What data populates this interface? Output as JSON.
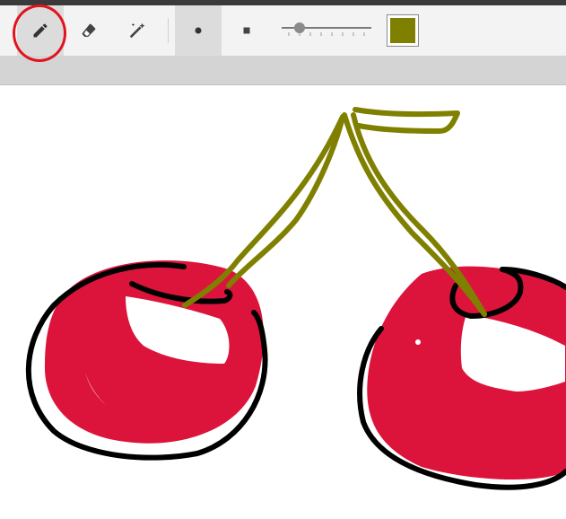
{
  "toolbar": {
    "tools": [
      {
        "name": "pencil-icon",
        "active": true
      },
      {
        "name": "eraser-icon",
        "active": false
      },
      {
        "name": "magic-wand-icon",
        "active": false
      }
    ],
    "brush_shapes": [
      {
        "name": "round-brush-icon",
        "active": true
      },
      {
        "name": "square-brush-icon",
        "active": false
      }
    ],
    "brush_size_level": 0.15,
    "current_color": "#808000"
  },
  "colors": {
    "cherry_fill": "#dc143c",
    "outline": "#000000",
    "stem": "#808000",
    "highlight_ring": "#e0141e"
  }
}
